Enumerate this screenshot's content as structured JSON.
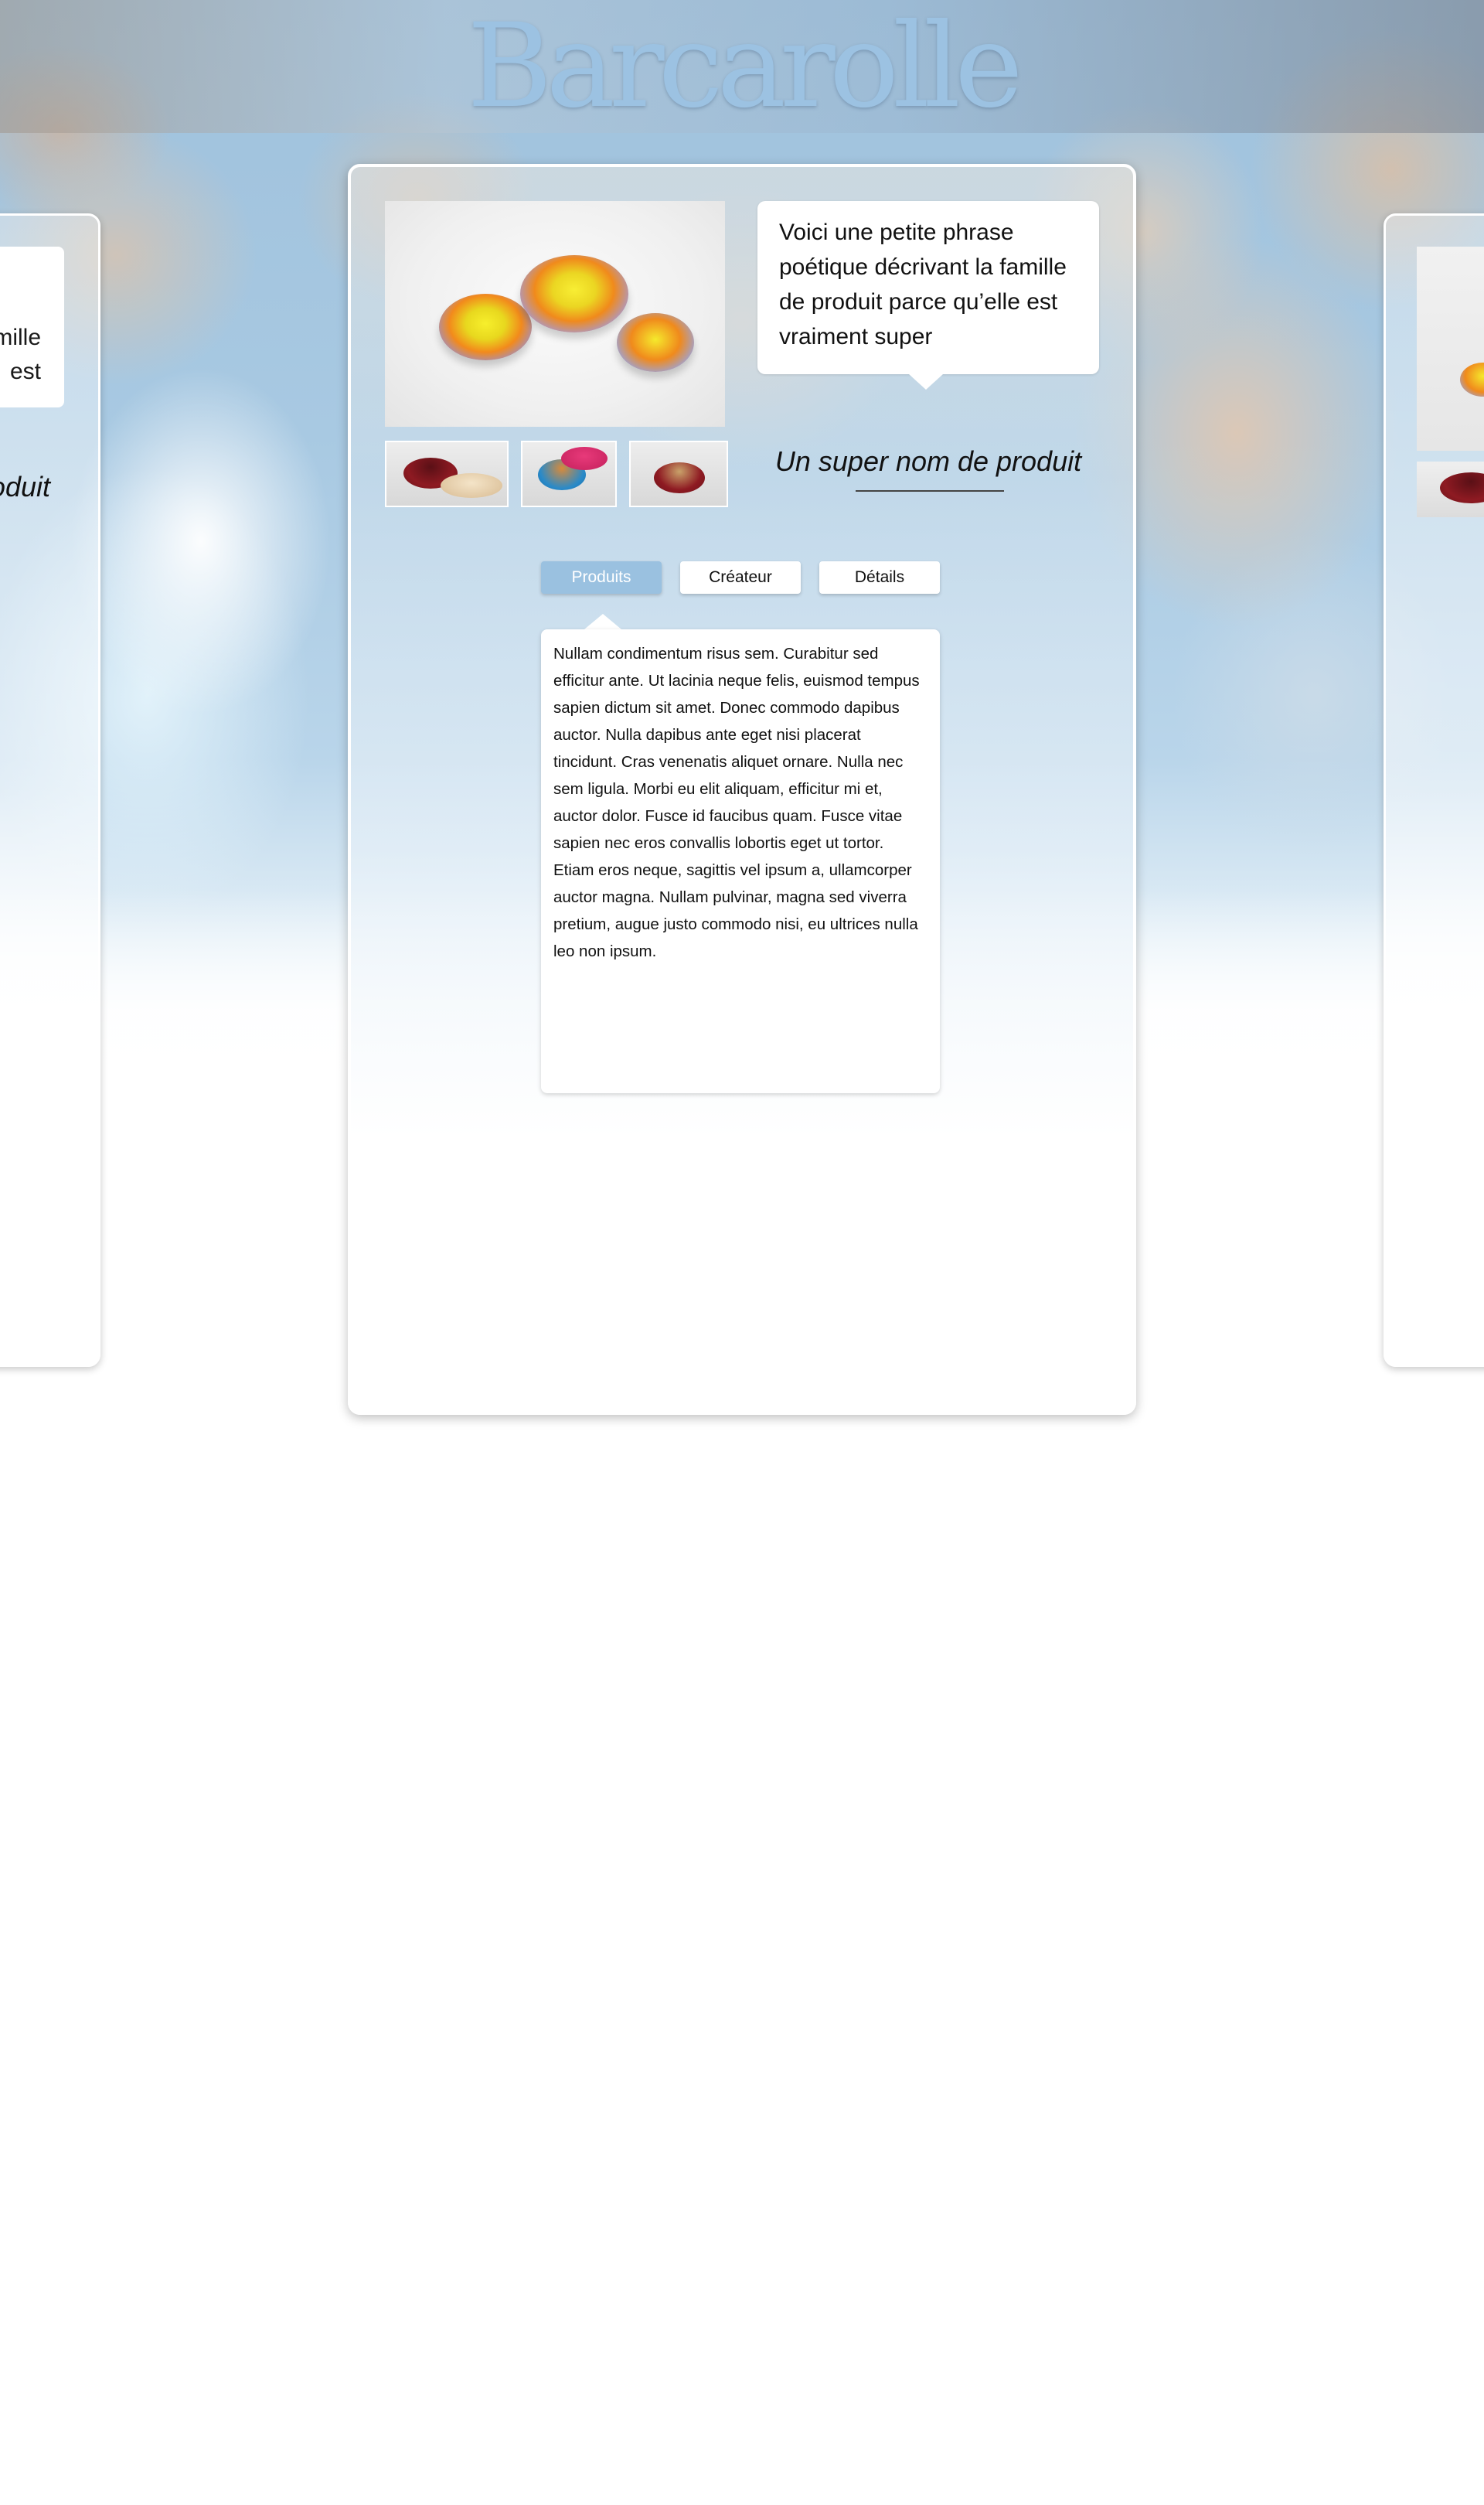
{
  "header": {
    "logo_text": "Barcarolle",
    "logo_color": "#9cc2e2"
  },
  "side_left": {
    "peek_text_line1": "mille",
    "peek_text_line2": "est",
    "peek_name": "oduit"
  },
  "product": {
    "tagline": "Voici une petite phrase poétique décrivant la famille de produit parce qu’elle est vraiment super",
    "name": "Un super nom de produit",
    "main_image": "bowls-photo",
    "thumbnails": [
      "red-bowls-thumbnail",
      "blue-pink-bowls-thumbnail",
      "red-bowl-thumbnail"
    ]
  },
  "tabs": [
    {
      "label": "Produits",
      "active": true
    },
    {
      "label": "Créateur",
      "active": false
    },
    {
      "label": "Détails",
      "active": false
    }
  ],
  "tab_content": {
    "text": "Nullam condimentum risus sem. Curabitur sed efficitur ante. Ut lacinia neque felis, euismod tempus sapien dictum sit amet. Donec commodo dapibus auctor. Nulla dapibus ante eget nisi placerat tincidunt. Cras venenatis aliquet ornare. Nulla nec sem ligula. Morbi eu elit aliquam, efficitur mi et, auctor dolor. Fusce id faucibus quam. Fusce vitae sapien nec eros convallis lobortis eget ut tortor. Etiam eros neque, sagittis vel ipsum a, ullamcorper auctor magna. Nullam pulvinar, magna sed viverra pretium, augue justo commodo nisi, eu ultrices nulla leo non ipsum."
  },
  "colors": {
    "accent": "#9ac1e0",
    "card_border": "#ffffff",
    "text": "#111111"
  }
}
